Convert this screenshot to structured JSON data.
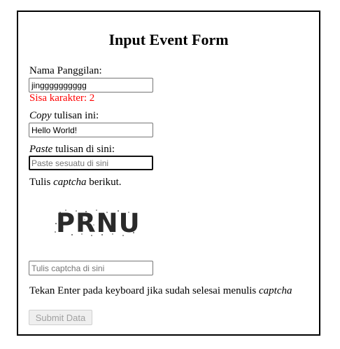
{
  "form": {
    "title": "Input Event Form",
    "nickname": {
      "label": "Nama Panggilan:",
      "value": "jingggggggggg",
      "counter": "Sisa karakter: 2"
    },
    "copy": {
      "label_em": "Copy",
      "label_rest": " tulisan ini:",
      "value": "Hello World!"
    },
    "paste": {
      "label_em": "Paste",
      "label_rest": " tulisan di sini:",
      "placeholder": "Paste sesuatu di sini"
    },
    "captcha": {
      "label_pre": "Tulis ",
      "label_em": "captcha",
      "label_post": " berikut.",
      "image_text": "PRNU",
      "placeholder": "Tulis captcha di sini"
    },
    "instruction": {
      "text": "Tekan Enter pada keyboard jika sudah selesai menulis ",
      "em": "captcha"
    },
    "submit_label": "Submit Data"
  }
}
